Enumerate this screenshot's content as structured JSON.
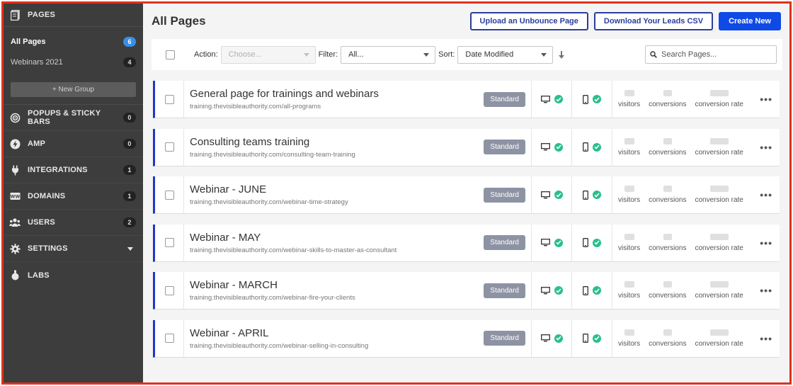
{
  "sidebar": {
    "header": {
      "label": "PAGES",
      "icon": "pages-icon"
    },
    "groups": [
      {
        "label": "All Pages",
        "count": "6",
        "active": true
      },
      {
        "label": "Webinars 2021",
        "count": "4",
        "active": false
      }
    ],
    "new_group_label": "+ New Group",
    "items": [
      {
        "label": "POPUPS & STICKY BARS",
        "count": "0",
        "icon": "target-icon"
      },
      {
        "label": "AMP",
        "count": "0",
        "icon": "lightning-icon"
      },
      {
        "label": "INTEGRATIONS",
        "count": "1",
        "icon": "plug-icon"
      },
      {
        "label": "DOMAINS",
        "count": "1",
        "icon": "domain-icon"
      },
      {
        "label": "USERS",
        "count": "2",
        "icon": "users-icon"
      },
      {
        "label": "SETTINGS",
        "count": "",
        "icon": "gear-icon"
      },
      {
        "label": "LABS",
        "count": "",
        "icon": "flask-icon"
      }
    ]
  },
  "header": {
    "title": "All Pages",
    "upload_label": "Upload an Unbounce Page",
    "download_label": "Download Your Leads CSV",
    "create_label": "Create New"
  },
  "toolbar": {
    "action_label": "Action:",
    "action_placeholder": "Choose...",
    "filter_label": "Filter:",
    "filter_value": "All...",
    "sort_label": "Sort:",
    "sort_value": "Date Modified",
    "search_placeholder": "Search Pages..."
  },
  "stat_labels": {
    "visitors": "visitors",
    "conversions": "conversions",
    "conversion_rate": "conversion rate"
  },
  "pages": [
    {
      "title": "General page for trainings and webinars",
      "url": "training.thevisibleauthority.com/all-programs",
      "badge": "Standard"
    },
    {
      "title": "Consulting teams training",
      "url": "training.thevisibleauthority.com/consulting-team-training",
      "badge": "Standard"
    },
    {
      "title": "Webinar - JUNE",
      "url": "training.thevisibleauthority.com/webinar-time-strategy",
      "badge": "Standard"
    },
    {
      "title": "Webinar - MAY",
      "url": "training.thevisibleauthority.com/webinar-skills-to-master-as-consultant",
      "badge": "Standard"
    },
    {
      "title": "Webinar - MARCH",
      "url": "training.thevisibleauthority.com/webinar-fire-your-clients",
      "badge": "Standard"
    },
    {
      "title": "Webinar - APRIL",
      "url": "training.thevisibleauthority.com/webinar-selling-in-consulting",
      "badge": "Standard"
    }
  ],
  "colors": {
    "accent": "#0f4ae6",
    "row_marker": "#2137c8",
    "check": "#29c08a",
    "sidebar": "#3d3d3d",
    "frame": "#e0321b"
  }
}
